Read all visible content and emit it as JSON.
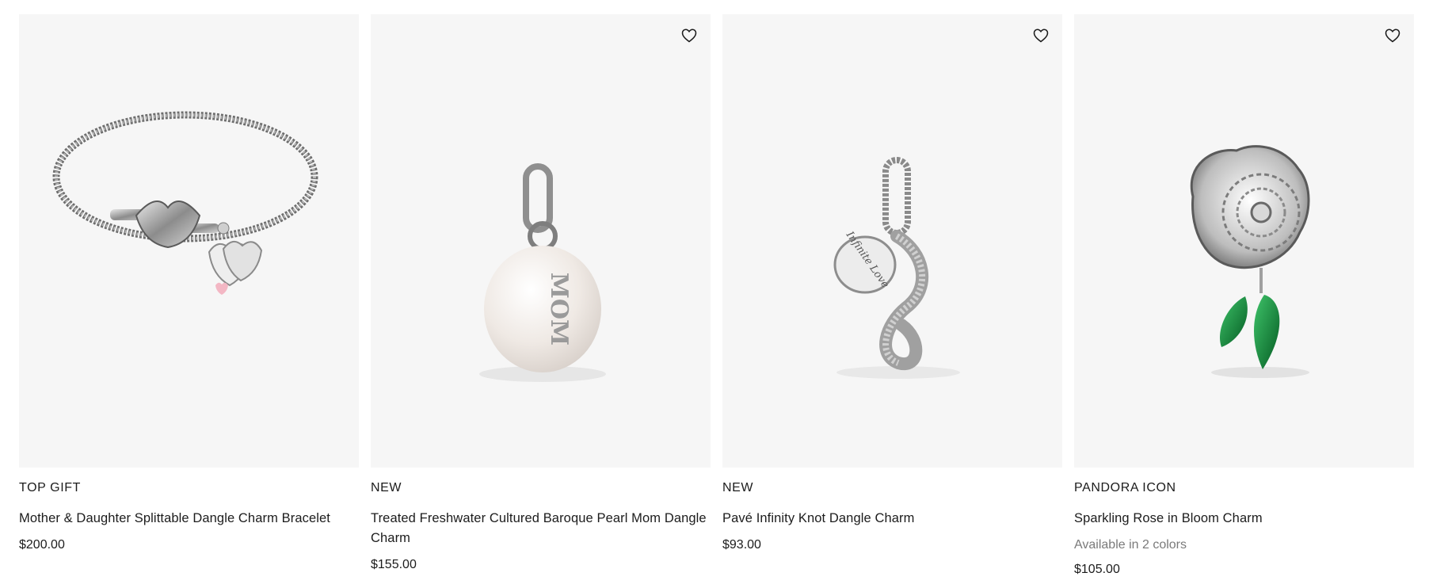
{
  "products": [
    {
      "tag": "TOP GIFT",
      "title": "Mother & Daughter Splittable Dangle Charm Bracelet",
      "price": "$200.00",
      "has_wishlist": false
    },
    {
      "tag": "NEW",
      "title": "Treated Freshwater Cultured Baroque Pearl Mom Dangle Charm",
      "price": "$155.00",
      "has_wishlist": true,
      "engraving": "MOM"
    },
    {
      "tag": "NEW",
      "title": "Pavé Infinity Knot Dangle Charm",
      "price": "$93.00",
      "has_wishlist": true,
      "engraving": "Infinite Love"
    },
    {
      "tag": "PANDORA ICON",
      "title": "Sparkling Rose in Bloom Charm",
      "colors_note": "Available in 2 colors",
      "price": "$105.00",
      "has_wishlist": true
    }
  ],
  "icons": {
    "wishlist": "heart-outline-icon"
  },
  "colors": {
    "image_bg": "#f6f6f6",
    "text": "#1c1c1c",
    "muted": "#7a7a7a",
    "stone_green": "#0e8a3a",
    "enamel_pink": "#f3b7c4"
  }
}
